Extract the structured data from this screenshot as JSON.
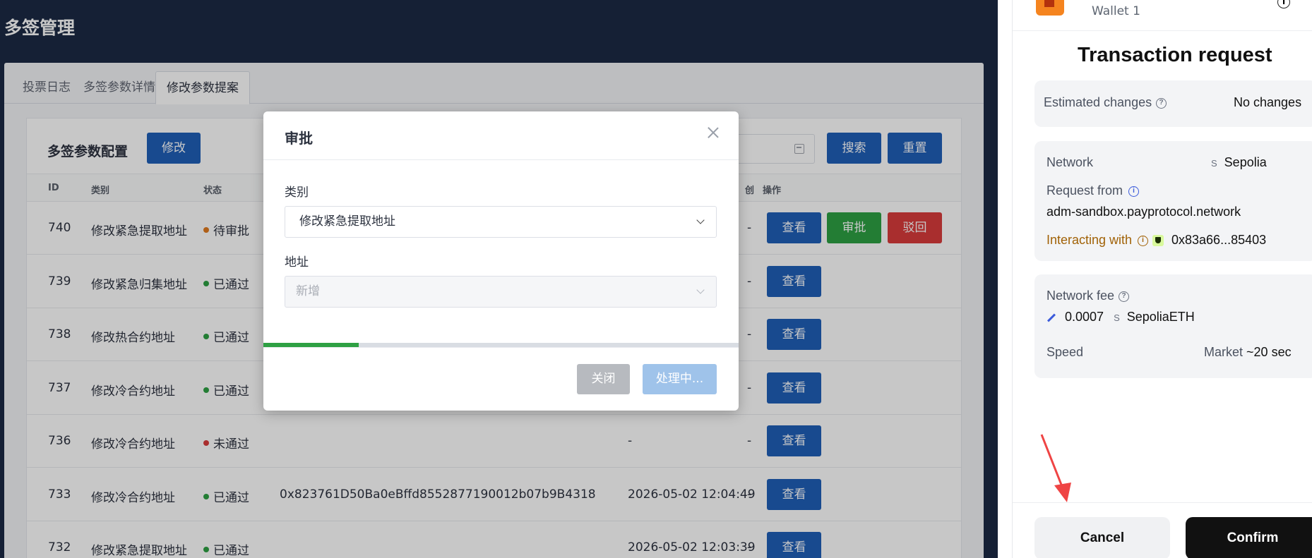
{
  "app": {
    "title": "多签管理",
    "tabs": [
      "投票日志",
      "多签参数详情",
      "修改参数提案"
    ],
    "active_tab": 2,
    "panel_title": "多签参数配置",
    "edit_label": "修改",
    "search_label": "搜索",
    "reset_label": "重置",
    "columns": [
      "ID",
      "类别",
      "状态",
      "创",
      "操作"
    ],
    "view_label": "查看",
    "approve_label": "审批",
    "reject_label": "驳回",
    "rows": [
      {
        "id": "740",
        "category": "修改紧急提取地址",
        "status": "待审批",
        "status_color": "#e07a1f",
        "address": "",
        "time": "",
        "op": "-",
        "actions": [
          "view",
          "approve",
          "reject"
        ]
      },
      {
        "id": "739",
        "category": "修改紧急归集地址",
        "status": "已通过",
        "status_color": "#2ea043",
        "address": "",
        "time": "",
        "op": "-",
        "actions": [
          "view"
        ]
      },
      {
        "id": "738",
        "category": "修改热合约地址",
        "status": "已通过",
        "status_color": "#2ea043",
        "address": "",
        "time": "",
        "op": "-",
        "actions": [
          "view"
        ]
      },
      {
        "id": "737",
        "category": "修改冷合约地址",
        "status": "已通过",
        "status_color": "#2ea043",
        "address": "",
        "time": "",
        "op": "-",
        "actions": [
          "view"
        ]
      },
      {
        "id": "736",
        "category": "修改冷合约地址",
        "status": "未通过",
        "status_color": "#d93c3c",
        "address": "",
        "time": "-",
        "op": "-",
        "actions": [
          "view"
        ]
      },
      {
        "id": "733",
        "category": "修改冷合约地址",
        "status": "已通过",
        "status_color": "#2ea043",
        "address": "0x823761D50Ba0eBffd8552877190012b07b9B4318",
        "time": "2026-05-02 12:04:49",
        "op": "-",
        "actions": [
          "view"
        ]
      },
      {
        "id": "732",
        "category": "修改紧急提取地址",
        "status": "已通过",
        "status_color": "#2ea043",
        "address": "",
        "time": "2026-05-02 12:03:39",
        "op": "-",
        "actions": [
          "view"
        ]
      }
    ]
  },
  "modal": {
    "title": "审批",
    "type_label": "类别",
    "type_value": "修改紧急提取地址",
    "address_label": "地址",
    "address_placeholder": "新增",
    "progress": 0.2,
    "close_label": "关闭",
    "processing_label": "处理中..."
  },
  "wallet": {
    "account": "Wallet 1",
    "title": "Transaction request",
    "estimated_changes_label": "Estimated changes",
    "estimated_changes_value": "No changes",
    "network_label": "Network",
    "network_value": "Sepolia",
    "network_badge": "S",
    "request_from_label": "Request from",
    "request_from_value": "adm-sandbox.payprotocol.network",
    "interacting_with_label": "Interacting with",
    "interacting_with_value": "0x83a66...85403",
    "network_fee_label": "Network fee",
    "network_fee_amount": "0.0007",
    "network_fee_unit": "SepoliaETH",
    "speed_label": "Speed",
    "speed_mode": "Market",
    "speed_value": "~20 sec",
    "cancel_label": "Cancel",
    "confirm_label": "Confirm",
    "accent_color": "#111111",
    "warning_color": "#a16207"
  }
}
